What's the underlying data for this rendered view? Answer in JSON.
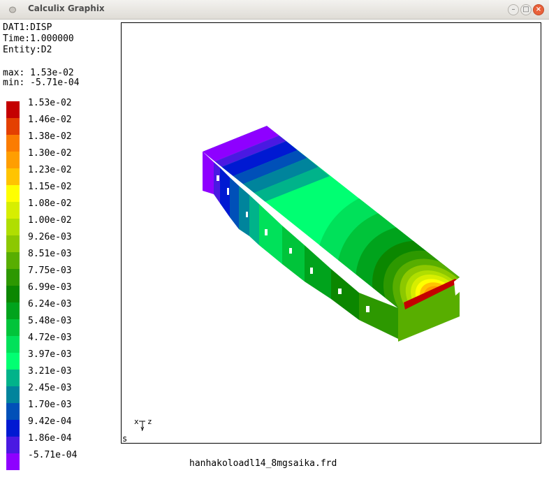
{
  "window": {
    "title": "Calculix Graphix",
    "buttons": {
      "minimize": "–",
      "maximize": "□",
      "close": "×"
    }
  },
  "info": {
    "dataset": "DAT1:DISP",
    "time": "Time:1.000000",
    "entity": "Entity:D2",
    "max": "max: 1.53e-02",
    "min": "min: -5.71e-04"
  },
  "legend": [
    {
      "label": "1.53e-02",
      "color": "#c40000"
    },
    {
      "label": "1.46e-02",
      "color": "#e44000"
    },
    {
      "label": "1.38e-02",
      "color": "#fb7c00"
    },
    {
      "label": "1.30e-02",
      "color": "#ff9e00"
    },
    {
      "label": "1.23e-02",
      "color": "#ffc400"
    },
    {
      "label": "1.15e-02",
      "color": "#ffff00"
    },
    {
      "label": "1.08e-02",
      "color": "#d7ee00"
    },
    {
      "label": "1.00e-02",
      "color": "#b0de00"
    },
    {
      "label": "9.26e-03",
      "color": "#8cc800"
    },
    {
      "label": "8.51e-03",
      "color": "#58ae00"
    },
    {
      "label": "7.75e-03",
      "color": "#2d9800"
    },
    {
      "label": "6.99e-03",
      "color": "#0b8700"
    },
    {
      "label": "6.24e-03",
      "color": "#00a31c"
    },
    {
      "label": "5.48e-03",
      "color": "#00c43a"
    },
    {
      "label": "4.72e-03",
      "color": "#00e15a"
    },
    {
      "label": "3.97e-03",
      "color": "#00ff72"
    },
    {
      "label": "3.21e-03",
      "color": "#00b38a"
    },
    {
      "label": "2.45e-03",
      "color": "#00849c"
    },
    {
      "label": "1.70e-03",
      "color": "#0050b8"
    },
    {
      "label": "9.42e-04",
      "color": "#0019d2"
    },
    {
      "label": "1.86e-04",
      "color": "#4a19e2"
    },
    {
      "label": "-5.71e-04",
      "color": "#8e00ff"
    }
  ],
  "viewport": {
    "axis_label": "xyz",
    "status_char": "s"
  },
  "filename": "hanhakoloadl14_8mgsaika.frd"
}
